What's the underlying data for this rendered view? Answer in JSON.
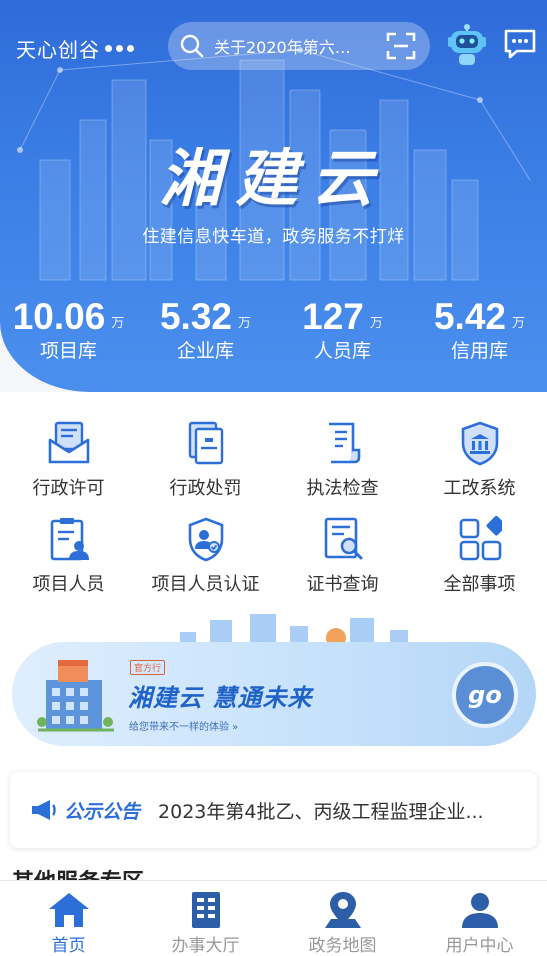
{
  "header": {
    "company": "天心创谷",
    "search_text": "关于2020年第六批次...",
    "brand_title": "湘建云",
    "brand_subtitle": "住建信息快车道，政务服务不打烊",
    "stats": [
      {
        "value": "10.06",
        "unit": "万",
        "label": "项目库"
      },
      {
        "value": "5.32",
        "unit": "万",
        "label": "企业库"
      },
      {
        "value": "127",
        "unit": "万",
        "label": "人员库"
      },
      {
        "value": "5.42",
        "unit": "万",
        "label": "信用库"
      }
    ]
  },
  "services": [
    {
      "label": "行政许可",
      "icon": "envelope-icon"
    },
    {
      "label": "行政处罚",
      "icon": "document-stamp-icon"
    },
    {
      "label": "执法检查",
      "icon": "scroll-icon"
    },
    {
      "label": "工改系统",
      "icon": "bank-shield-icon"
    },
    {
      "label": "项目人员",
      "icon": "clipboard-person-icon"
    },
    {
      "label": "项目人员认证",
      "icon": "shield-person-icon"
    },
    {
      "label": "证书查询",
      "icon": "certificate-search-icon"
    },
    {
      "label": "全部事项",
      "icon": "grid-apps-icon"
    }
  ],
  "banner": {
    "tag": "官方行",
    "title": "湘建云  慧通未来",
    "subtitle": "给您带来不一样的体验 »",
    "button": "go"
  },
  "notice": {
    "tag": "公示公告",
    "text": "2023年第4批乙、丙级工程监理企业..."
  },
  "section_heading": "其他服务专区",
  "nav": [
    {
      "label": "首页",
      "icon": "home-icon",
      "active": true
    },
    {
      "label": "办事大厅",
      "icon": "building-icon",
      "active": false
    },
    {
      "label": "政务地图",
      "icon": "map-pin-icon",
      "active": false
    },
    {
      "label": "用户中心",
      "icon": "user-icon",
      "active": false
    }
  ],
  "colors": {
    "primary": "#2d6fd8",
    "header": "#3b7fe6",
    "inactive": "#999999"
  }
}
